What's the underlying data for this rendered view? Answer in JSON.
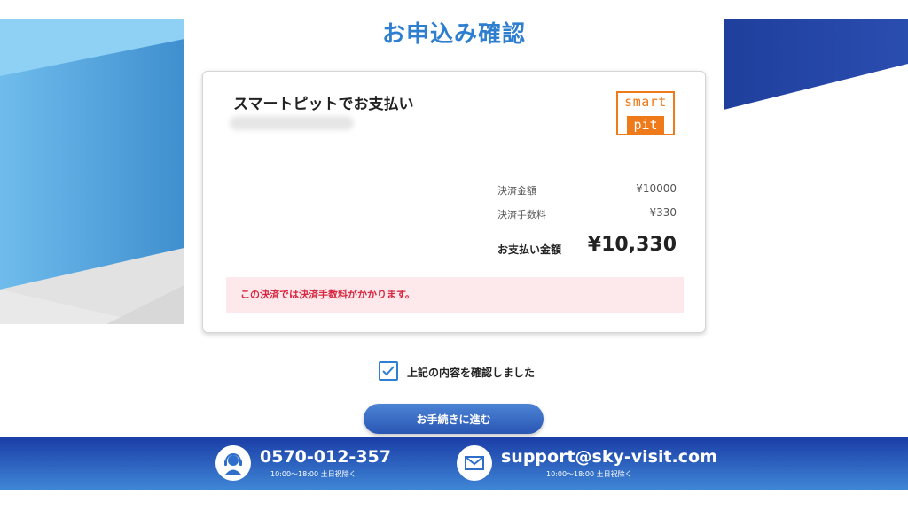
{
  "page": {
    "title": "お申込み確認"
  },
  "payment": {
    "method_title": "スマートピットでお支払い",
    "logo": {
      "top_text": "smart",
      "bottom_text": "pit"
    },
    "rows": [
      {
        "label": "決済金額",
        "value": "¥10000"
      },
      {
        "label": "決済手数料",
        "value": "¥330"
      }
    ],
    "total": {
      "label": "お支払い金額",
      "value": "¥10,330"
    },
    "notice": "この決済では決済手数料がかかります。"
  },
  "confirmation": {
    "checked": true,
    "label": "上記の内容を確認しました"
  },
  "actions": {
    "proceed_label": "お手続きに進む"
  },
  "footer": {
    "phone": {
      "number": "0570-012-357",
      "hours": "10:00〜18:00 土日祝除く",
      "icon": "headset-icon"
    },
    "email": {
      "address": "support@sky-visit.com",
      "hours": "10:00〜18:00 土日祝除く",
      "icon": "mail-icon"
    }
  },
  "colors": {
    "accent": "#2f7fd0",
    "logo_orange": "#ee7a1a",
    "notice_text": "#d8273f",
    "notice_bg": "#fde8ec",
    "footer": "#1a3ca6"
  }
}
